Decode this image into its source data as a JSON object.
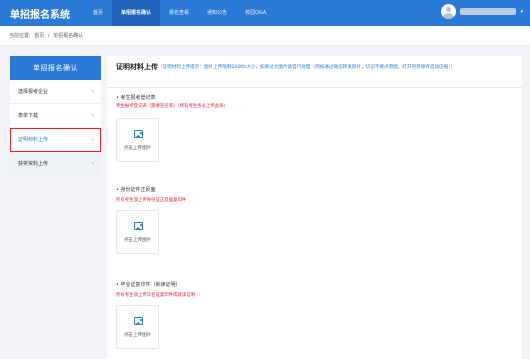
{
  "header": {
    "brand": "单招报名系统",
    "nav": [
      "首页",
      "单招报名确认",
      "报名查看",
      "通知公告",
      "校园Q&A"
    ],
    "active_nav": 1,
    "user_caret": "▾"
  },
  "breadcrumb": {
    "prefix": "当前位置:",
    "home": "首页",
    "sep": "/",
    "current": "单招报名确认"
  },
  "sidebar": {
    "title": "单招报名确认",
    "items": [
      {
        "label": "选择报考企业"
      },
      {
        "label": "表单下载"
      },
      {
        "label": "证明材料上传"
      },
      {
        "label": "获奖资料上传"
      }
    ],
    "active_index": 2,
    "arrow": "›"
  },
  "main": {
    "title": "证明材料上传",
    "note": "（证明材料上传提示：图片上传限制200Kb大小，如果过大图片请自行处理（例如通过微信转发照片，切记不要点原图，打开另存保存自动压缩））",
    "sections": [
      {
        "title": "考生报考登记表",
        "note": "考生报考登记表（需要签名等）（所有考生务必上传此表）",
        "upload_label": "点击上传图片"
      },
      {
        "title": "身份证件正反面",
        "note": "所有考生须上传身份证正反面复印件",
        "upload_label": "点击上传图片"
      },
      {
        "title": "毕业证复印件（就读证明）",
        "note": "所有考生须上传毕业证复印件或就读证明",
        "upload_label": "点击上传图片"
      }
    ]
  },
  "colors": {
    "primary": "#2a7bd6",
    "highlight_outline": "#e2242b",
    "note_red": "#e2242b"
  }
}
